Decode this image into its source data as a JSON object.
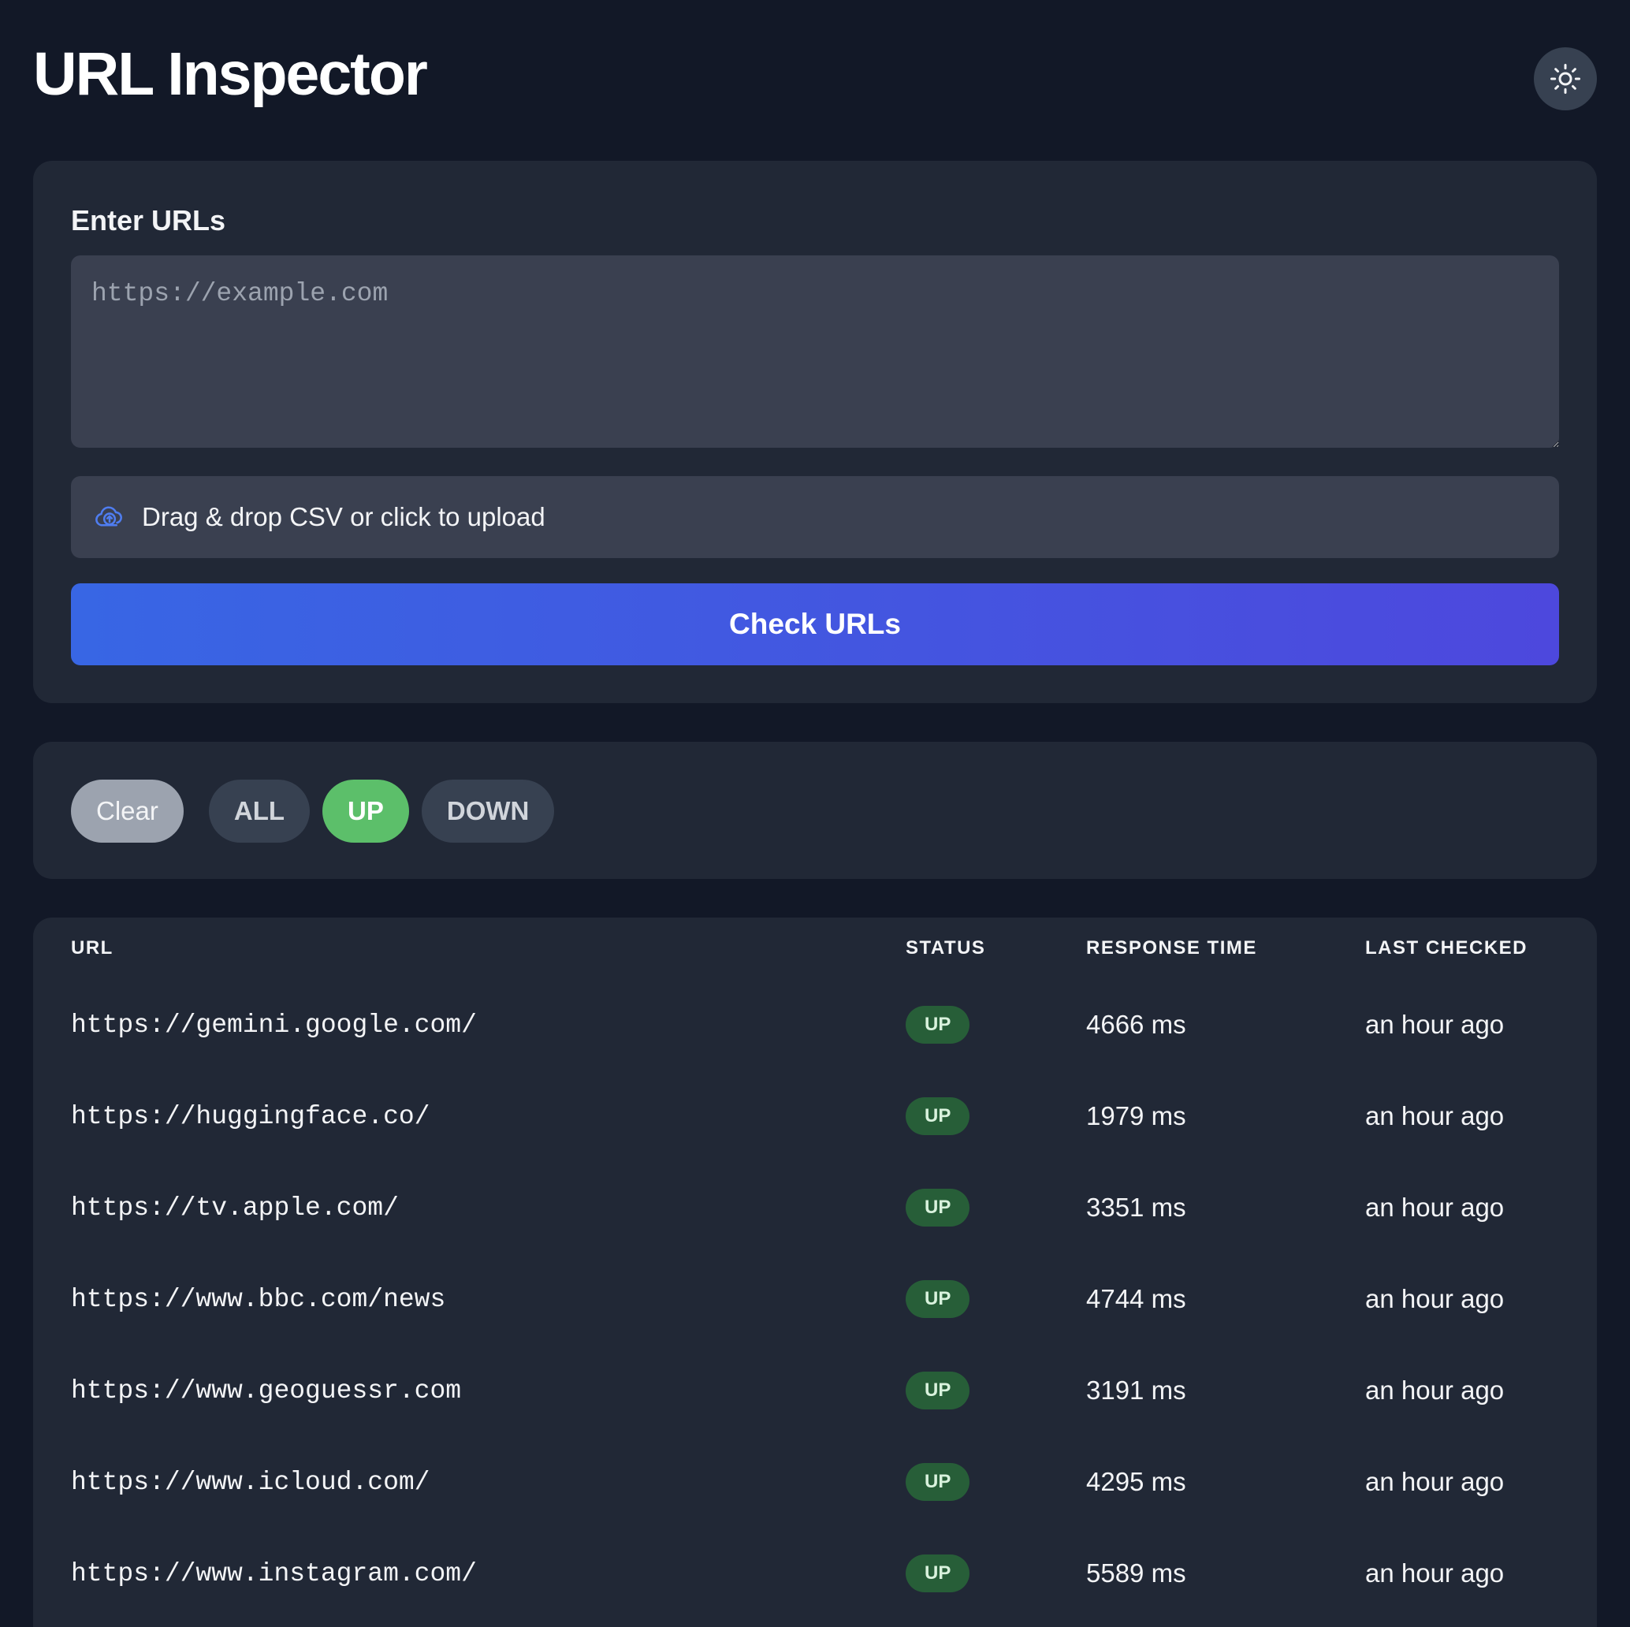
{
  "header": {
    "title": "URL Inspector",
    "theme_icon": "sun-icon"
  },
  "input_card": {
    "section_label": "Enter URLs",
    "textarea_placeholder": "https://example.com",
    "textarea_value": "",
    "upload_icon": "cloud-upload-icon",
    "upload_label": "Drag & drop CSV or click to upload",
    "check_button_label": "Check URLs"
  },
  "filters": {
    "clear_label": "Clear",
    "options": [
      {
        "label": "ALL",
        "active": false
      },
      {
        "label": "UP",
        "active": true
      },
      {
        "label": "DOWN",
        "active": false
      }
    ]
  },
  "table": {
    "columns": [
      "URL",
      "STATUS",
      "RESPONSE TIME",
      "LAST CHECKED"
    ],
    "rows": [
      {
        "url": "https://gemini.google.com/",
        "status": "UP",
        "response_time": "4666 ms",
        "last_checked": "an hour ago"
      },
      {
        "url": "https://huggingface.co/",
        "status": "UP",
        "response_time": "1979 ms",
        "last_checked": "an hour ago"
      },
      {
        "url": "https://tv.apple.com/",
        "status": "UP",
        "response_time": "3351 ms",
        "last_checked": "an hour ago"
      },
      {
        "url": "https://www.bbc.com/news",
        "status": "UP",
        "response_time": "4744 ms",
        "last_checked": "an hour ago"
      },
      {
        "url": "https://www.geoguessr.com",
        "status": "UP",
        "response_time": "3191 ms",
        "last_checked": "an hour ago"
      },
      {
        "url": "https://www.icloud.com/",
        "status": "UP",
        "response_time": "4295 ms",
        "last_checked": "an hour ago"
      },
      {
        "url": "https://www.instagram.com/",
        "status": "UP",
        "response_time": "5589 ms",
        "last_checked": "an hour ago"
      }
    ]
  },
  "colors": {
    "background": "#121827",
    "card": "#212836",
    "input": "#3a4050",
    "accent_start": "#3866e4",
    "accent_end": "#4d48dd",
    "up_filter": "#5cbf6a",
    "up_badge": "#275e38"
  }
}
